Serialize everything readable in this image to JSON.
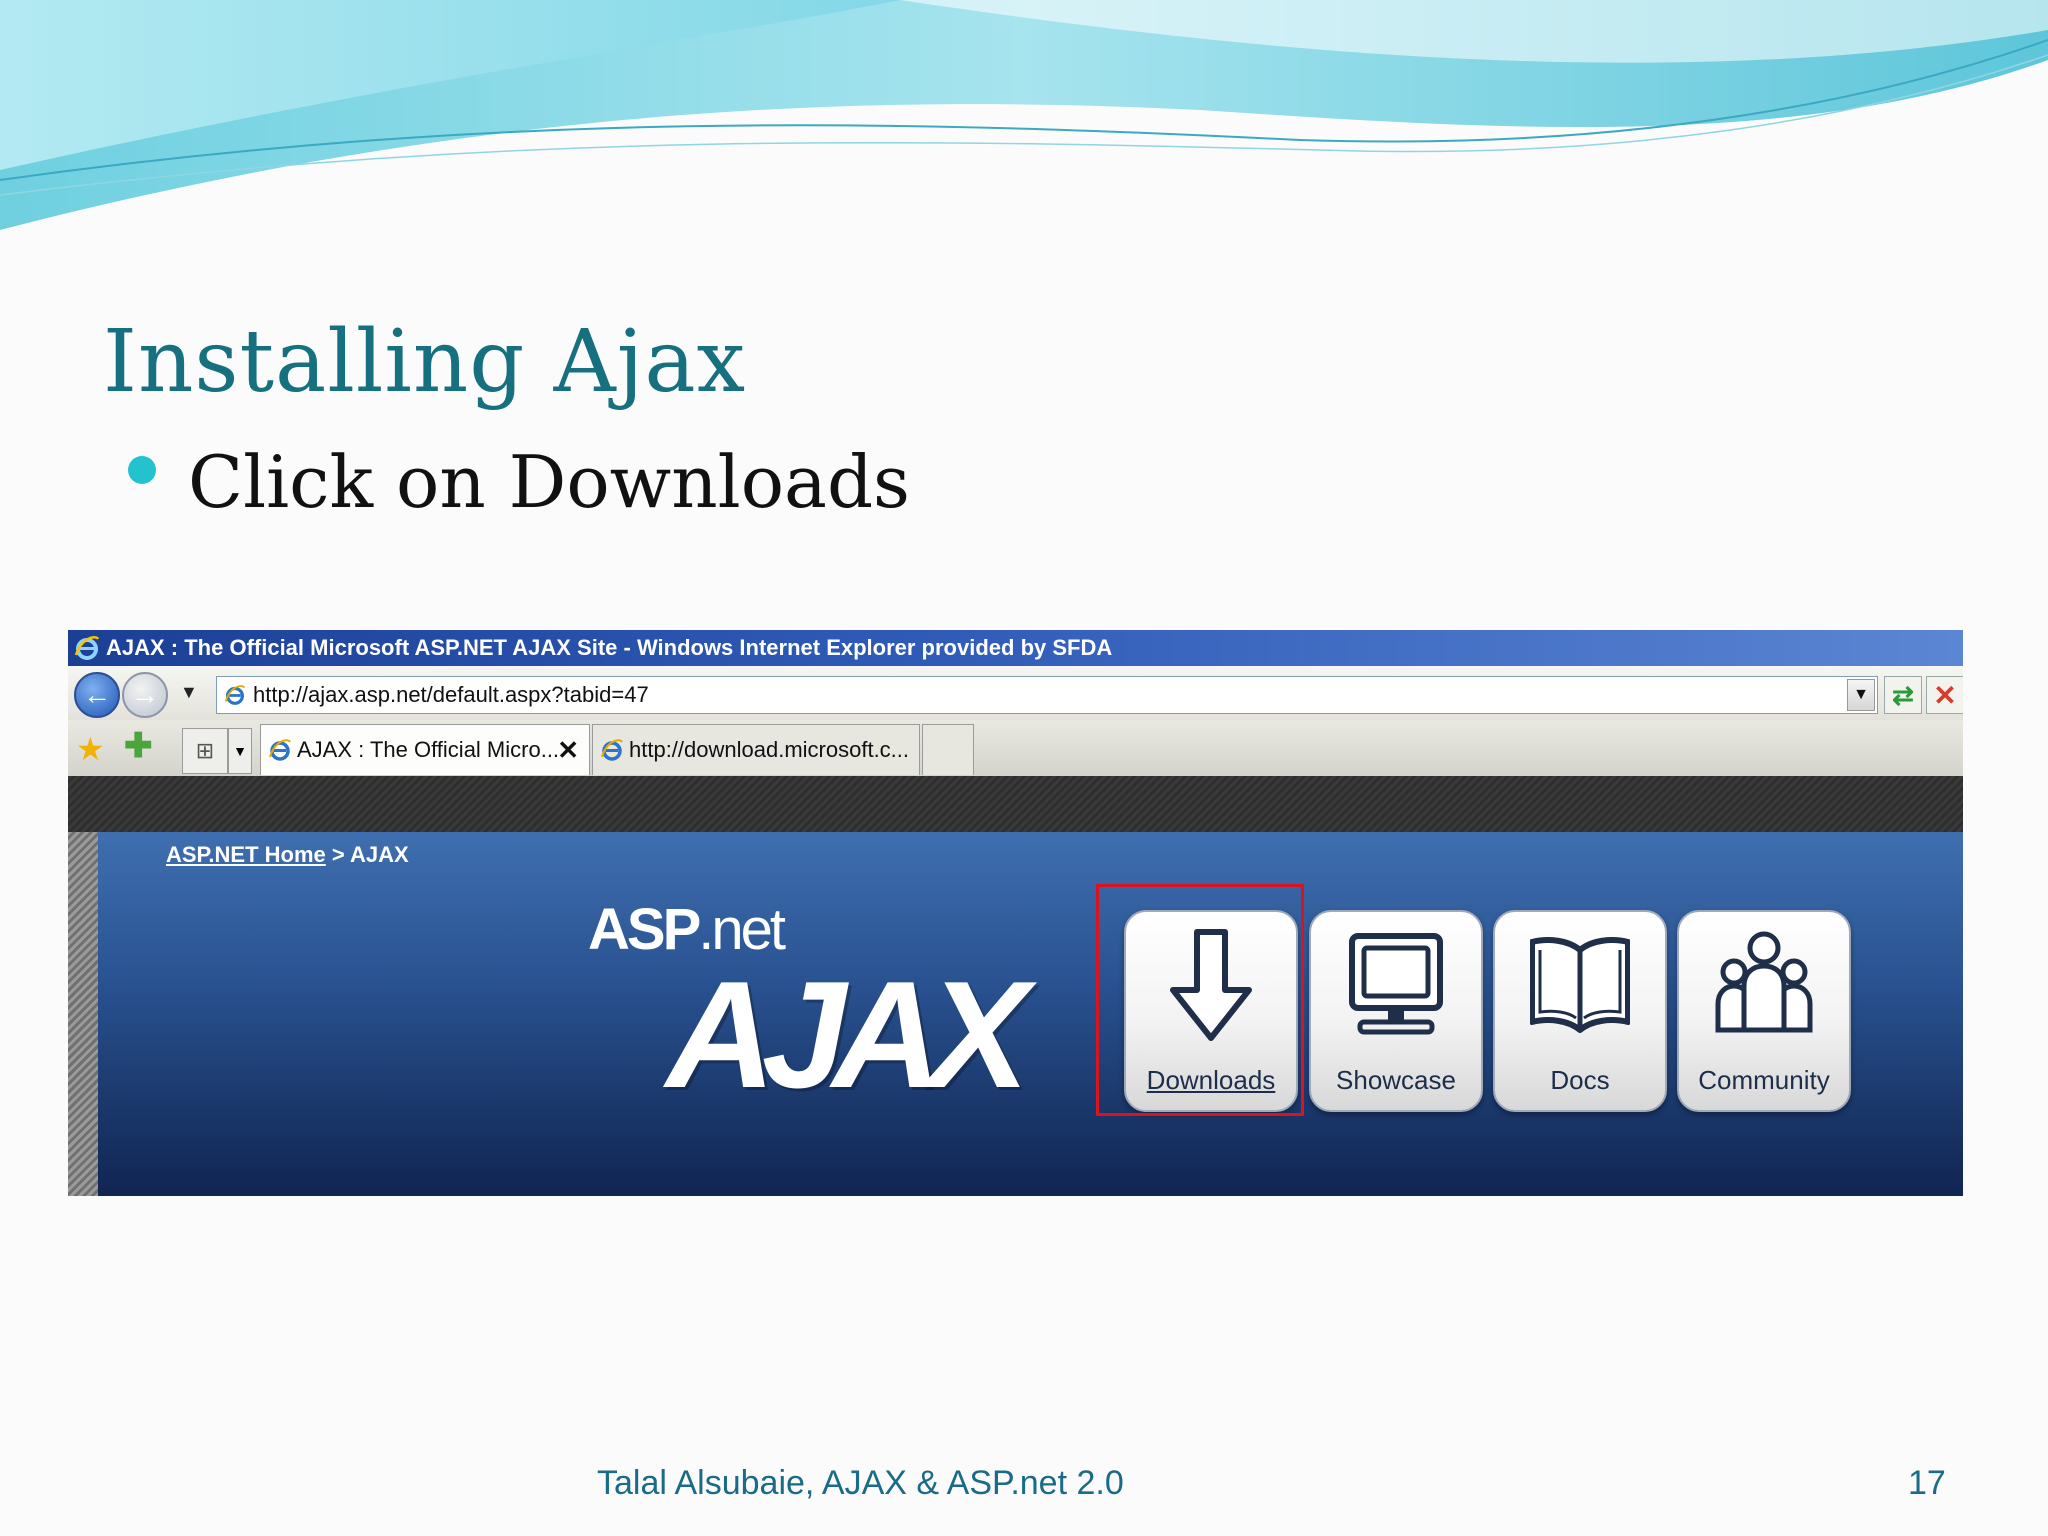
{
  "slide": {
    "title": "Installing Ajax",
    "bullet": "Click on Downloads",
    "footer": "Talal Alsubaie,  AJAX & ASP.net 2.0",
    "page_number": "17"
  },
  "browser": {
    "window_title": "AJAX : The Official Microsoft ASP.NET AJAX Site - Windows Internet Explorer provided by SFDA",
    "address": "http://ajax.asp.net/default.aspx?tabid=47",
    "tabs": [
      {
        "label": "AJAX : The Official Micro..."
      },
      {
        "label": "http://download.microsoft.c..."
      }
    ]
  },
  "site": {
    "breadcrumb_home": "ASP.NET Home",
    "breadcrumb_sep": " > ",
    "breadcrumb_current": "AJAX",
    "logo_asp": "ASP",
    "logo_net": ".net",
    "logo_ajax": "AJAX",
    "nav": [
      {
        "label": "Downloads",
        "icon": "download-arrow-icon"
      },
      {
        "label": "Showcase",
        "icon": "computer-monitor-icon"
      },
      {
        "label": "Docs",
        "icon": "open-book-icon"
      },
      {
        "label": "Community",
        "icon": "people-group-icon"
      }
    ]
  },
  "colors": {
    "title": "#17707f",
    "bullet": "#22c3cf",
    "highlight": "#d9141e",
    "footer": "#1a6b85"
  }
}
